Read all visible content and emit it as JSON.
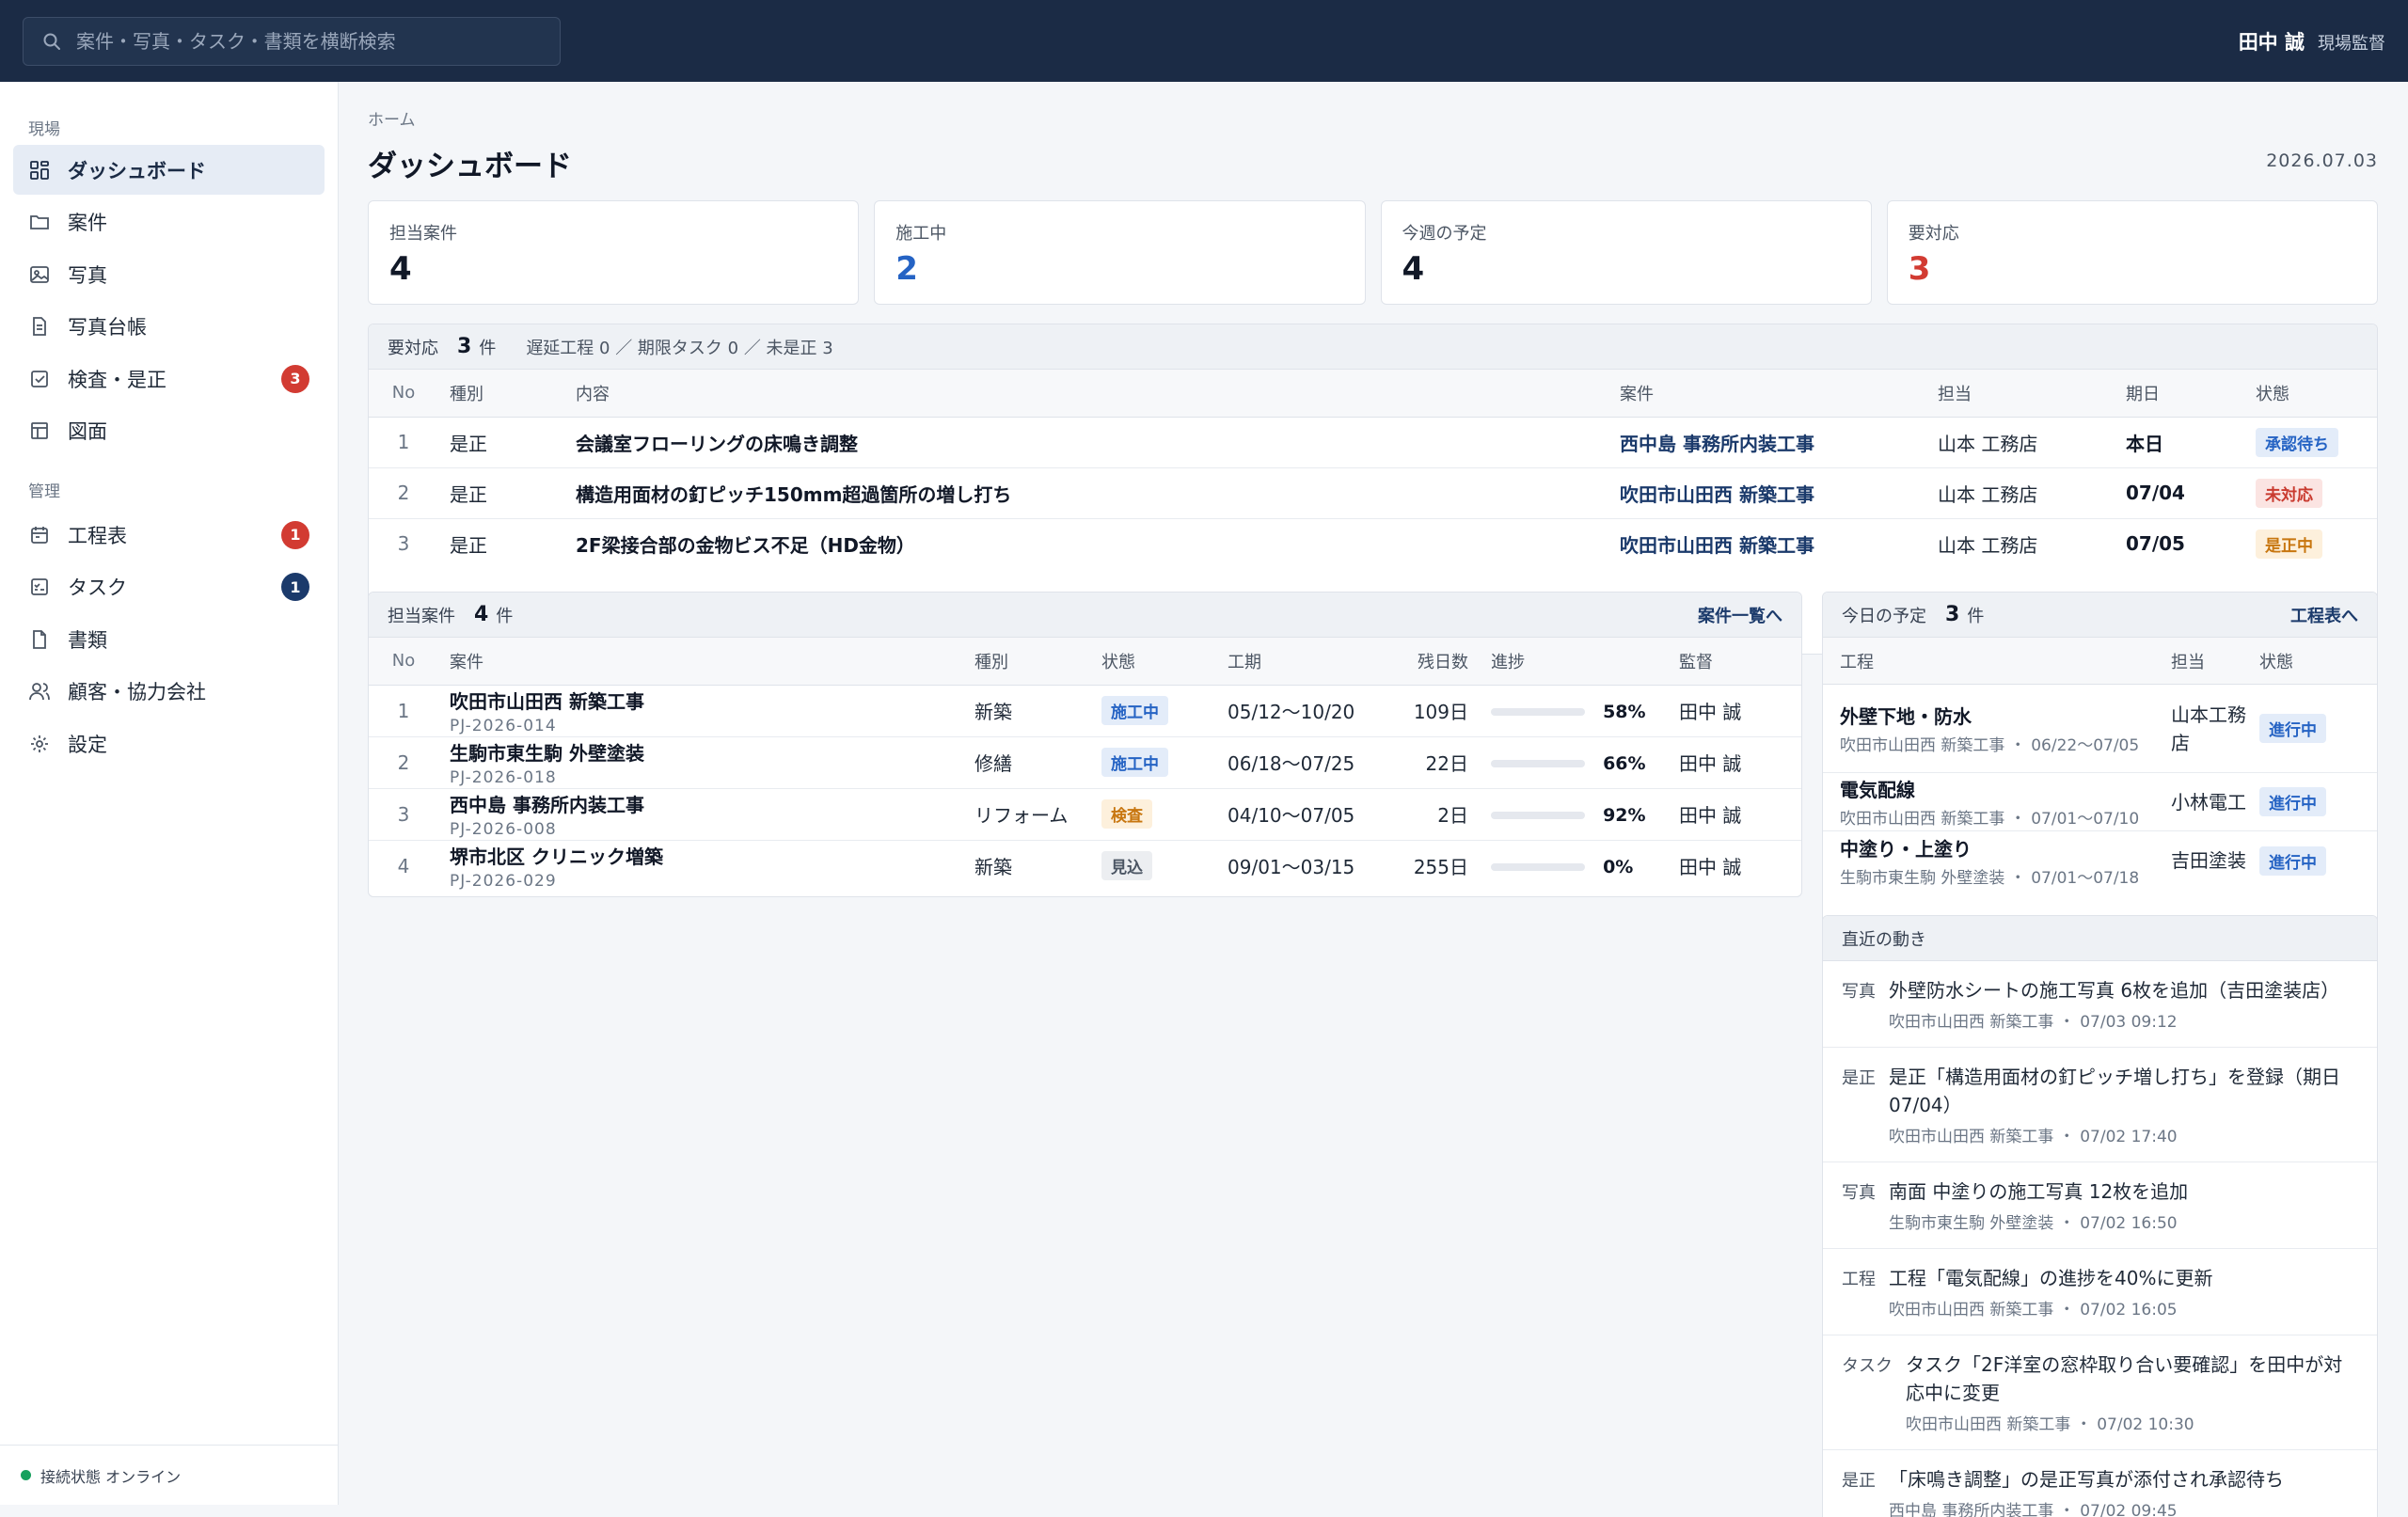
{
  "search": {
    "placeholder": "案件・写真・タスク・書類を横断検索"
  },
  "user": {
    "name": "田中 誠",
    "role": "現場監督"
  },
  "sidebar": {
    "section1": "現場",
    "section2": "管理",
    "items1": [
      {
        "label": "ダッシュボード",
        "badge": ""
      },
      {
        "label": "案件",
        "badge": ""
      },
      {
        "label": "写真",
        "badge": ""
      },
      {
        "label": "写真台帳",
        "badge": ""
      },
      {
        "label": "検査・是正",
        "badge": "3"
      },
      {
        "label": "図面",
        "badge": ""
      }
    ],
    "items2": [
      {
        "label": "工程表",
        "badge": "1"
      },
      {
        "label": "タスク",
        "badge": "1"
      },
      {
        "label": "書類",
        "badge": ""
      },
      {
        "label": "顧客・協力会社",
        "badge": ""
      },
      {
        "label": "設定",
        "badge": ""
      }
    ],
    "connection": "接続状態 オンライン"
  },
  "page": {
    "breadcrumb": "ホーム",
    "title": "ダッシュボード",
    "date": "2026.07.03"
  },
  "kpis": [
    {
      "label": "担当案件",
      "value": "4"
    },
    {
      "label": "施工中",
      "value": "2"
    },
    {
      "label": "今週の予定",
      "value": "4"
    },
    {
      "label": "要対応",
      "value": "3"
    }
  ],
  "urgent": {
    "title": "要対応",
    "count": "3",
    "unit": "件",
    "summary": "遅延工程 0 ／ 期限タスク 0 ／ 未是正 3",
    "columns": [
      "No",
      "種別",
      "内容",
      "案件",
      "担当",
      "期日",
      "状態"
    ],
    "rows": [
      {
        "no": "1",
        "type": "是正",
        "content": "会議室フローリングの床鳴き調整",
        "project": "西中島 事務所内装工事",
        "person": "山本 工務店",
        "due": "本日",
        "status": "承認待ち"
      },
      {
        "no": "2",
        "type": "是正",
        "content": "構造用面材の釘ピッチ150mm超過箇所の増し打ち",
        "project": "吹田市山田西 新築工事",
        "person": "山本 工務店",
        "due": "07/04",
        "status": "未対応"
      },
      {
        "no": "3",
        "type": "是正",
        "content": "2F梁接合部の金物ビス不足（HD金物）",
        "project": "吹田市山田西 新築工事",
        "person": "山本 工務店",
        "due": "07/05",
        "status": "是正中"
      }
    ]
  },
  "projects": {
    "title": "担当案件",
    "count": "4",
    "unit": "件",
    "link": "案件一覧へ",
    "columns": [
      "No",
      "案件",
      "種別",
      "状態",
      "工期",
      "残日数",
      "進捗",
      "監督"
    ],
    "rows": [
      {
        "no": "1",
        "name": "吹田市山田西 新築工事",
        "code": "PJ-2026-014",
        "type": "新築",
        "status": "施工中",
        "period": "05/12〜10/20",
        "remain": "109日",
        "progress": 58,
        "progress_label": "58%",
        "manager": "田中 誠"
      },
      {
        "no": "2",
        "name": "生駒市東生駒 外壁塗装",
        "code": "PJ-2026-018",
        "type": "修繕",
        "status": "施工中",
        "period": "06/18〜07/25",
        "remain": "22日",
        "progress": 66,
        "progress_label": "66%",
        "manager": "田中 誠"
      },
      {
        "no": "3",
        "name": "西中島 事務所内装工事",
        "code": "PJ-2026-008",
        "type": "リフォーム",
        "status": "検査",
        "period": "04/10〜07/05",
        "remain": "2日",
        "progress": 92,
        "progress_label": "92%",
        "manager": "田中 誠"
      },
      {
        "no": "4",
        "name": "堺市北区 クリニック増築",
        "code": "PJ-2026-029",
        "type": "新築",
        "status": "見込",
        "period": "09/01〜03/15",
        "remain": "255日",
        "progress": 0,
        "progress_label": "0%",
        "manager": "田中 誠"
      }
    ]
  },
  "today": {
    "title": "今日の予定",
    "count": "3",
    "unit": "件",
    "link": "工程表へ",
    "columns": [
      "工程",
      "担当",
      "状態"
    ],
    "rows": [
      {
        "work": "外壁下地・防水",
        "meta": "吹田市山田西 新築工事 ・ 06/22〜07/05",
        "person": "山本工務店",
        "status": "進行中"
      },
      {
        "work": "電気配線",
        "meta": "吹田市山田西 新築工事 ・ 07/01〜07/10",
        "person": "小林電工",
        "status": "進行中"
      },
      {
        "work": "中塗り・上塗り",
        "meta": "生駒市東生駒 外壁塗装 ・ 07/01〜07/18",
        "person": "吉田塗装",
        "status": "進行中"
      }
    ]
  },
  "activity": {
    "title": "直近の動き",
    "items": [
      {
        "type": "写真",
        "text": "外壁防水シートの施工写真 6枚を追加（吉田塗装店）",
        "meta": "吹田市山田西 新築工事 ・ 07/03 09:12"
      },
      {
        "type": "是正",
        "text": "是正「構造用面材の釘ピッチ増し打ち」を登録（期日 07/04）",
        "meta": "吹田市山田西 新築工事 ・ 07/02 17:40"
      },
      {
        "type": "写真",
        "text": "南面 中塗りの施工写真 12枚を追加",
        "meta": "生駒市東生駒 外壁塗装 ・ 07/02 16:50"
      },
      {
        "type": "工程",
        "text": "工程「電気配線」の進捗を40%に更新",
        "meta": "吹田市山田西 新築工事 ・ 07/02 16:05"
      },
      {
        "type": "タスク",
        "text": "タスク「2F洋室の窓枠取り合い要確認」を田中が対応中に変更",
        "meta": "吹田市山田西 新築工事 ・ 07/02 10:30"
      },
      {
        "type": "是正",
        "text": "「床鳴き調整」の是正写真が添付され承認待ち",
        "meta": "西中島 事務所内装工事 ・ 07/02 09:45"
      }
    ]
  }
}
